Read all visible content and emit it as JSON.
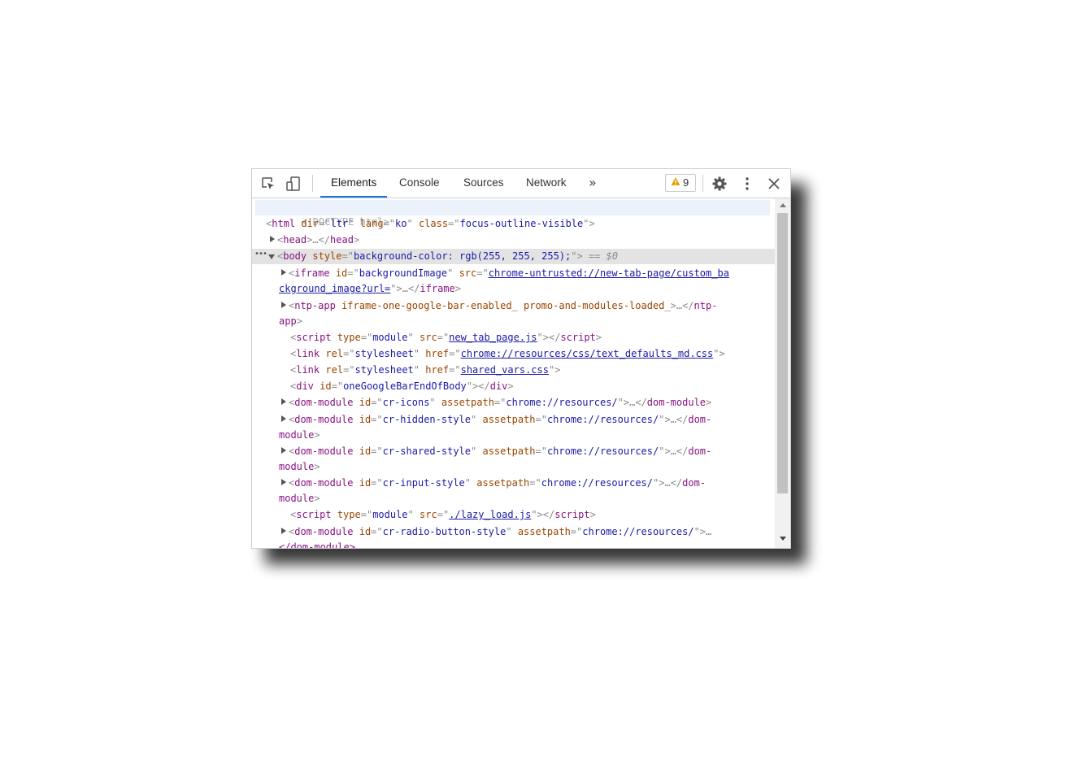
{
  "toolbar": {
    "tabs": [
      {
        "label": "Elements",
        "active": true
      },
      {
        "label": "Console"
      },
      {
        "label": "Sources"
      },
      {
        "label": "Network"
      }
    ],
    "more_tabs": "»",
    "warning_count": "9"
  },
  "dom": {
    "l1": "<!DOCTYPE html>",
    "l2": {
      "open": "<",
      "tag": "html",
      "a1": "dir",
      "v1": "ltr",
      "a2": "lang",
      "v2": "ko",
      "a3": "class",
      "v3": "focus-outline-visible",
      "close": ">"
    },
    "l3": {
      "open": "<",
      "tag": "head",
      "mid": ">…</",
      "close": ">"
    },
    "l4": {
      "tag": "body",
      "attr": "style",
      "val": "background-color: rgb(255, 255, 255);",
      "suffix": "== $0"
    },
    "l5": {
      "tag": "iframe",
      "a1": "id",
      "v1": "backgroundImage",
      "a2": "src",
      "link1": "chrome-untrusted://new-tab-page/custom_ba",
      "link2": "ckground_image?url=",
      "end": "iframe"
    },
    "l6": {
      "tag": "ntp-app",
      "attrs": "iframe-one-google-bar-enabled_ promo-and-modules-loaded_",
      "end1": "ntp-",
      "end2": "app"
    },
    "l7": {
      "tag": "script",
      "a1": "type",
      "v1": "module",
      "a2": "src",
      "link": "new_tab_page.js"
    },
    "l8": {
      "tag": "link",
      "a1": "rel",
      "v1": "stylesheet",
      "a2": "href",
      "link": "chrome://resources/css/text_defaults_md.css"
    },
    "l9": {
      "tag": "link",
      "a1": "rel",
      "v1": "stylesheet",
      "a2": "href",
      "link": "shared_vars.css"
    },
    "l10": {
      "tag": "div",
      "a1": "id",
      "v1": "oneGoogleBarEndOfBody"
    },
    "modules": [
      {
        "id": "cr-icons",
        "path": "chrome://resources/"
      },
      {
        "id": "cr-hidden-style",
        "path": "chrome://resources/"
      },
      {
        "id": "cr-shared-style",
        "path": "chrome://resources/"
      },
      {
        "id": "cr-input-style",
        "path": "chrome://resources/"
      },
      {
        "id": "cr-radio-button-style",
        "path": "chrome://resources/"
      }
    ],
    "dm_tag": "dom-module",
    "dm_attr_id": "id",
    "dm_attr_path": "assetpath",
    "end_dom": "dom-",
    "end_module": "module",
    "l_lazy": {
      "tag": "script",
      "a1": "type",
      "v1": "module",
      "a2": "src",
      "link": "./lazy_load.js"
    },
    "last_partial": "</dom-module>"
  }
}
